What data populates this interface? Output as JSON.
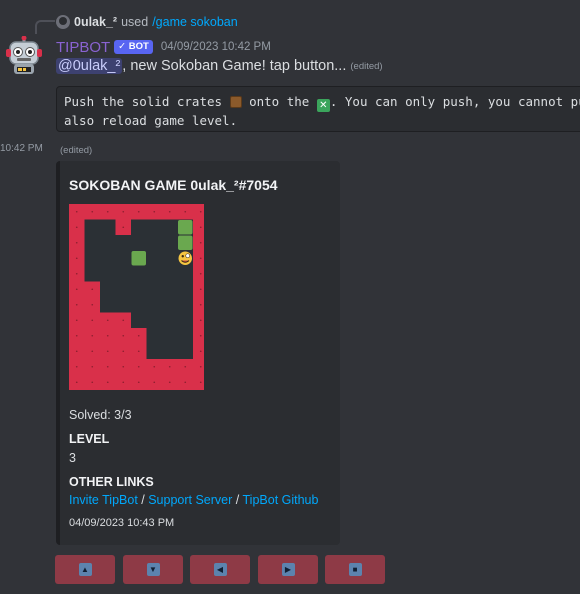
{
  "reply": {
    "user": "0ulak_²",
    "used_text": "used",
    "command": "/game sokoban"
  },
  "message": {
    "author": "TIPBOT",
    "bot_tag": "✓ BOT",
    "timestamp": "04/09/2023 10:42 PM",
    "mention": "@0ulak_²",
    "text_after_mention": ", new Sokoban Game! tap button...",
    "edited_label": "(edited)",
    "code_line1_a": "Push the solid crates ",
    "code_line1_b": " onto the ",
    "code_line1_c": ". You can only push, you cannot pull. You can",
    "code_line2": "also reload game level.",
    "xbox_glyph": "✕",
    "side_time": "10:42 PM",
    "edited_label_2": "(edited)"
  },
  "embed": {
    "title": "SOKOBAN GAME 0ulak_²#7054",
    "solved": "Solved: 3/3",
    "level_label": "LEVEL",
    "level_value": "3",
    "links_label": "OTHER LINKS",
    "links": [
      "Invite TipBot",
      "Support Server",
      "TipBot Github"
    ],
    "link_separator": " / ",
    "footer_time": "04/09/2023 10:43 PM",
    "board": {
      "rows": [
        "#########",
        "#  #   G#",
        "#      G#",
        "#   B  P#",
        "#       #",
        "##      #",
        "##      #",
        "####    #",
        "#####   #",
        "#####   #",
        "#########",
        "#########"
      ],
      "legend": {
        "#": "wall",
        " ": "floor",
        "G": "goal-filled",
        "B": "crate-on-goal",
        "P": "player"
      },
      "colors": {
        "wall": "#d9304a",
        "floor": "#2b3035",
        "goal": "#6aa84f",
        "player": "#f5c542"
      }
    }
  },
  "buttons": [
    {
      "name": "up",
      "glyph": "▲"
    },
    {
      "name": "down",
      "glyph": "▼"
    },
    {
      "name": "left",
      "glyph": "◀"
    },
    {
      "name": "right",
      "glyph": "▶"
    },
    {
      "name": "reload",
      "glyph": "■"
    }
  ]
}
